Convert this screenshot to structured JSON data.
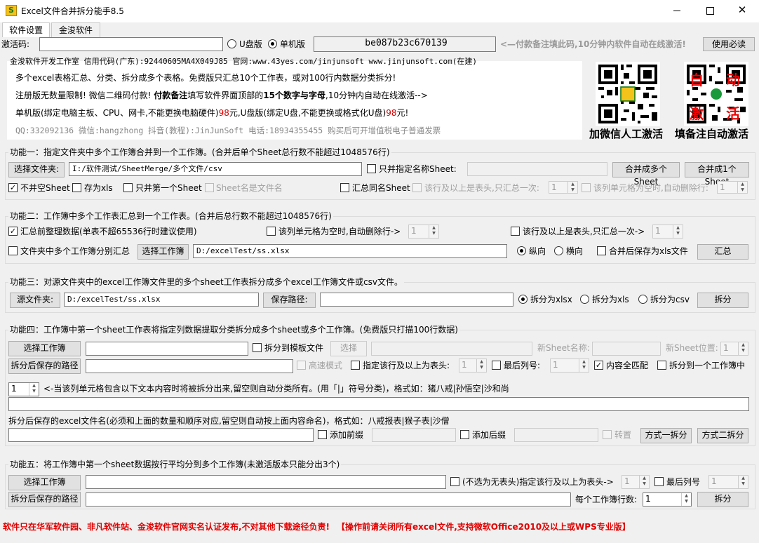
{
  "window": {
    "title": "Excel文件合并拆分能手8.5",
    "app_icon": "S",
    "min_icon": "minimize-icon",
    "max_icon": "maximize-icon",
    "close_icon": "close-icon"
  },
  "tabs": [
    "软件设置",
    "金浚软件"
  ],
  "activation": {
    "label": "激活码:",
    "usb_label": "U盘版",
    "machine_label": "单机版",
    "machine_selected": true,
    "code": "be087b23c670139",
    "hint": "<—付款备注填此码,10分钟内软件自动在线激活!",
    "must_read": "使用必读"
  },
  "info": {
    "line1": "金浚软件开发工作室 信用代码(广东):92440605MA4X049J85 官网:www.43yes.com/jinjunsoft  www.jinjunsoft.com(在建)",
    "line2": "多个excel表格汇总、分类、拆分成多个表格。免费版只汇总10个工作表，或对100行内数据分类拆分!",
    "line3a": "注册版无数量限制! 微信二维码付款! ",
    "line3b": "付款备注",
    "line3c": "填写软件界面顶部的",
    "line3d": "15个数字与字母",
    "line3e": ",10分钟内自动在线激活-->",
    "line4a": "单机版(绑定电脑主板、CPU、网卡,不能更换电脑硬件)",
    "line4b": "98",
    "line4c": "元,U盘版(绑定U盘,不能更换或格式化U盘)",
    "line4d": "98",
    "line4e": "元!",
    "line5": "QQ:332092136 微信:hangzhong 抖音(教程):JinJunSoft 电话:18934355455 购买后可开增值税电子普通发票",
    "qr1_caption": "加微信人工激活",
    "qr2_caption": "填备注自动激活",
    "qr2_red_chars": [
      "自",
      "动",
      "激",
      "活"
    ],
    "qr1_center": "S"
  },
  "f1": {
    "title": "功能一：指定文件夹中多个工作簿合并到一个工作簿。(合并后单个Sheet总行数不能超过1048576行)",
    "select_folder": "选择文件夹:",
    "folder_path": "I:/软件测试/SheetMerge/多个文件/csv",
    "only_named": "只并指定名称Sheet:",
    "merge_multi": "合并成多个Sheet",
    "merge_one": "合并成1个Sheet",
    "no_empty": "不并空Sheet",
    "save_xls": "存为xls",
    "first_only": "只并第一个Sheet",
    "sheet_is_file": "Sheet名是文件名",
    "sum_same": "汇总同名Sheet",
    "header_row": "该行及以上是表头,只汇总一次:",
    "header_val": "1",
    "empty_del": "该列单元格为空时,自动删除行:",
    "empty_val": "1"
  },
  "f2": {
    "title": "功能二：工作簿中多个工作表汇总到一个工作表。(合并后总行数不能超过1048576行)",
    "tidy": "汇总前整理数据(单表不超65536行时建议使用)",
    "empty_del": "该列单元格为空时,自动删除行->",
    "empty_val": "1",
    "header": "该行及以上是表头,只汇总一次->",
    "header_val": "1",
    "folder_sum": "文件夹中多个工作簿分别汇总",
    "select_wb": "选择工作簿",
    "path": "D:/excelTest/ss.xlsx",
    "vertical": "纵向",
    "horizontal": "横向",
    "save_xls": "合并后保存为xls文件",
    "sum_btn": "汇总"
  },
  "f3": {
    "title": "功能三：对源文件夹中的excel工作簿文件里的多个sheet工作表拆分成多个excel工作簿文件或csv文件。",
    "src": "源文件夹:",
    "src_path": "D:/excelTest/ss.xlsx",
    "save_path": "保存路径:",
    "xlsx": "拆分为xlsx",
    "xls": "拆分为xls",
    "csv": "拆分为csv",
    "split": "拆分"
  },
  "f4": {
    "title": "功能四：工作簿中第一个sheet工作表将指定列数据提取分类拆分成多个sheet或多个工作簿。(免费版只打描100行数据)",
    "select_wb": "选择工作簿",
    "to_template": "拆分到模板文件",
    "select": "选择",
    "new_sheet_name": "新Sheet名称:",
    "new_sheet_pos": "新Sheet位置:",
    "new_sheet_pos_val": "1",
    "save_path": "拆分后保存的路径",
    "fast": "高速模式",
    "header": "指定该行及以上为表头:",
    "header_val": "1",
    "last_col": "最后列号:",
    "last_col_val": "1",
    "full_match": "内容全匹配",
    "to_one_wb": "拆分到一个工作簿中",
    "col_val": "1",
    "col_hint": "<-当该列单元格包含以下文本内容时将被拆分出来,留空则自动分类所有。(用「|」符号分类)，格式如：猪八戒|孙悟空|沙和尚",
    "name_hint": "拆分后保存的excel文件名(必须和上面的数量和顺序对应,留空则自动按上面内容命名)，格式如：八戒报表|猴子表|沙僧",
    "prefix": "添加前缀",
    "suffix": "添加后缀",
    "transpose": "转置",
    "mode1": "方式一拆分",
    "mode2": "方式二拆分"
  },
  "f5": {
    "title": "功能五：将工作簿中第一个sheet数据按行平均分到多个工作簿(未激活版本只能分出3个)",
    "select_wb": "选择工作簿",
    "header": "(不选为无表头)指定该行及以上为表头->",
    "header_val": "1",
    "last_col": "最后列号",
    "last_col_val": "1",
    "save_path": "拆分后保存的路径",
    "rows_per": "每个工作簿行数:",
    "rows_val": "1",
    "split": "拆分"
  },
  "footer": {
    "left": "软件只在华军软件园、非凡软件站、金浚软件官网实名认证发布,不对其他下载途径负责!",
    "right": "【操作前请关闭所有excel文件,支持微软Office2010及以上或WPS专业版】"
  }
}
